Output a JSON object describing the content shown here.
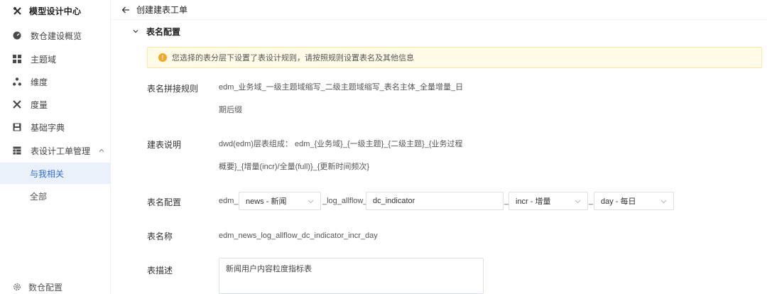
{
  "sidebar": {
    "brand": "模型设计中心",
    "items": [
      {
        "label": "数仓建设概览"
      },
      {
        "label": "主题域"
      },
      {
        "label": "维度"
      },
      {
        "label": "度量"
      },
      {
        "label": "基础字典"
      },
      {
        "label": "表设计工单管理"
      }
    ],
    "subitems": [
      {
        "label": "与我相关"
      },
      {
        "label": "全部"
      }
    ],
    "footer": "数仓配置"
  },
  "header": {
    "title": "创建建表工单"
  },
  "section": {
    "title": "表名配置"
  },
  "notice": {
    "text": "您选择的表分层下设置了表设计规则，请按照规则设置表名及其他信息"
  },
  "form": {
    "rule_label": "表名拼接规则",
    "rule_line1": "edm_业务域_一级主题域缩写_二级主题域缩写_表名主体_全量增量_日",
    "rule_line2": "期后缀",
    "desc_label": "建表说明",
    "desc_line1": "dwd(edm)层表组成： edm_{业务域}_{一级主题}_{二级主题}_{业务过程",
    "desc_line2": "概要}_{增量(incr)/全量(full)}_{更新时间频次}",
    "config_label": "表名配置",
    "prefix": "edm_",
    "domain_select": "news - 新闻",
    "mid_text": "_log_allflow_",
    "name_input": "dc_indicator",
    "sep1": "_",
    "mode_select": "incr - 增量",
    "sep2": "_",
    "freq_select": "day - 每日",
    "tablename_label": "表名称",
    "tablename_value": "edm_news_log_allflow_dc_indicator_incr_day",
    "tabledesc_label": "表描述",
    "tabledesc_value": "新闻用户内容粒度指标表"
  },
  "colors": {
    "accent": "#2f6fd6",
    "active_bg": "#eaf1fb",
    "warning": "#f5a623"
  }
}
